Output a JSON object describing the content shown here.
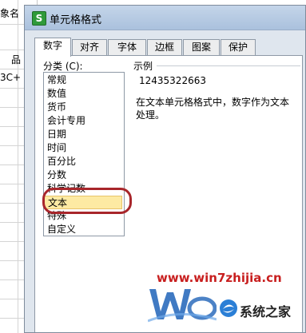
{
  "background_sheet": {
    "fragments": [
      "象名",
      "品",
      "3C+"
    ]
  },
  "dialog": {
    "title": "单元格格式",
    "app_icon_letter": "S",
    "tabs": [
      {
        "label": "数字",
        "active": true
      },
      {
        "label": "对齐",
        "active": false
      },
      {
        "label": "字体",
        "active": false
      },
      {
        "label": "边框",
        "active": false
      },
      {
        "label": "图案",
        "active": false
      },
      {
        "label": "保护",
        "active": false
      }
    ],
    "category_label": "分类 (C):",
    "categories": [
      "常规",
      "数值",
      "货币",
      "会计专用",
      "日期",
      "时间",
      "百分比",
      "分数",
      "科学记数",
      "文本",
      "特殊",
      "自定义"
    ],
    "selected_category": "文本",
    "sample_label": "示例",
    "sample_value": "12435322663",
    "description": "在文本单元格格式中，数字作为文本处理。"
  },
  "watermark": {
    "url": "www.win7zhijia.cn",
    "brand": "系统之家",
    "url_color": "#c81f1f"
  },
  "colors": {
    "selection_highlight": "#fdeaa3",
    "annotation_oval": "#a8262b",
    "app_icon_green": "#2f9a3a"
  }
}
